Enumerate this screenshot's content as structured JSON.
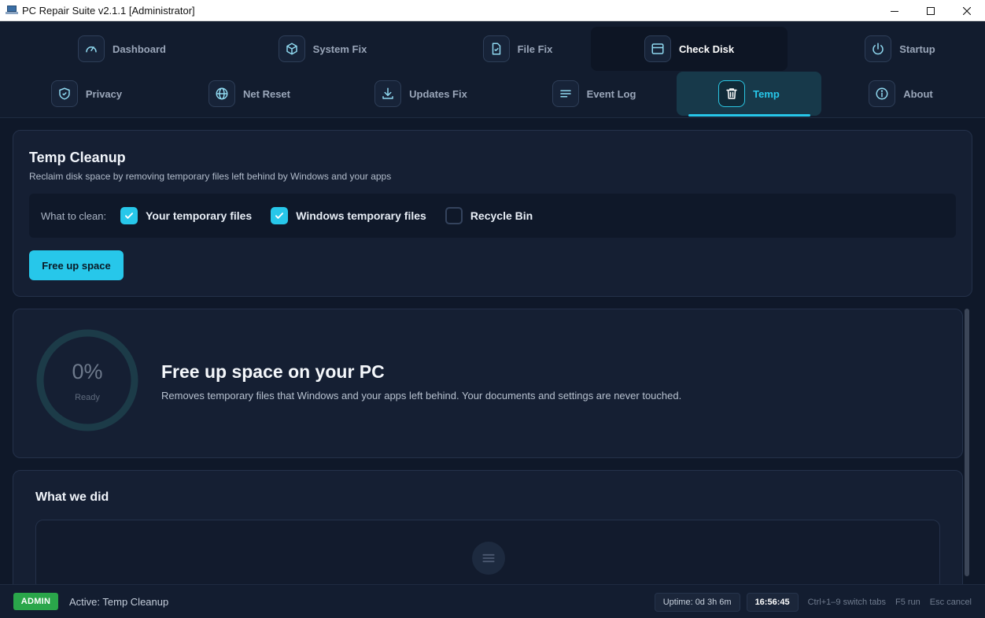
{
  "window": {
    "title": "PC Repair Suite v2.1.1 [Administrator]",
    "icon": "monitor-app-icon",
    "controls": [
      "minimize",
      "maximize",
      "close"
    ]
  },
  "tabs": {
    "row1": [
      {
        "label": "Dashboard",
        "icon": "gauge-icon"
      },
      {
        "label": "System Fix",
        "icon": "cube-icon"
      },
      {
        "label": "File Fix",
        "icon": "file-check-icon"
      },
      {
        "label": "Check Disk",
        "icon": "disk-icon"
      },
      {
        "label": "Startup",
        "icon": "power-icon"
      }
    ],
    "row2": [
      {
        "label": "Privacy",
        "icon": "shield-icon"
      },
      {
        "label": "Net Reset",
        "icon": "globe-icon"
      },
      {
        "label": "Updates Fix",
        "icon": "download-icon"
      },
      {
        "label": "Event Log",
        "icon": "list-icon"
      },
      {
        "label": "Temp",
        "icon": "trash-icon",
        "active": true
      },
      {
        "label": "About",
        "icon": "info-icon"
      }
    ]
  },
  "cleanup": {
    "title": "Temp Cleanup",
    "subtitle": "Reclaim disk space by removing temporary files left behind by Windows and your apps",
    "options_label": "What to clean:",
    "options": [
      {
        "label": "Your temporary files",
        "checked": true
      },
      {
        "label": "Windows temporary files",
        "checked": true
      },
      {
        "label": "Recycle Bin",
        "checked": false
      }
    ],
    "button": "Free up space"
  },
  "progress": {
    "percent": "0%",
    "percent_value": 0,
    "status": "Ready",
    "title": "Free up space on your PC",
    "description": "Removes temporary files that Windows and your apps left behind. Your documents and settings are never touched."
  },
  "log": {
    "title": "What we did"
  },
  "status": {
    "badge": "ADMIN",
    "active": "Active: Temp Cleanup",
    "uptime": "Uptime: 0d 3h 6m",
    "clock": "16:56:45",
    "hints": [
      {
        "key": "Ctrl+1–9",
        "action": "switch tabs"
      },
      {
        "key": "F5",
        "action": "run"
      },
      {
        "key": "Esc",
        "action": "cancel"
      }
    ]
  },
  "colors": {
    "accent": "#27c7ea",
    "background": "#0f1829",
    "card": "#151f33",
    "admin_badge": "#2aa64a"
  }
}
